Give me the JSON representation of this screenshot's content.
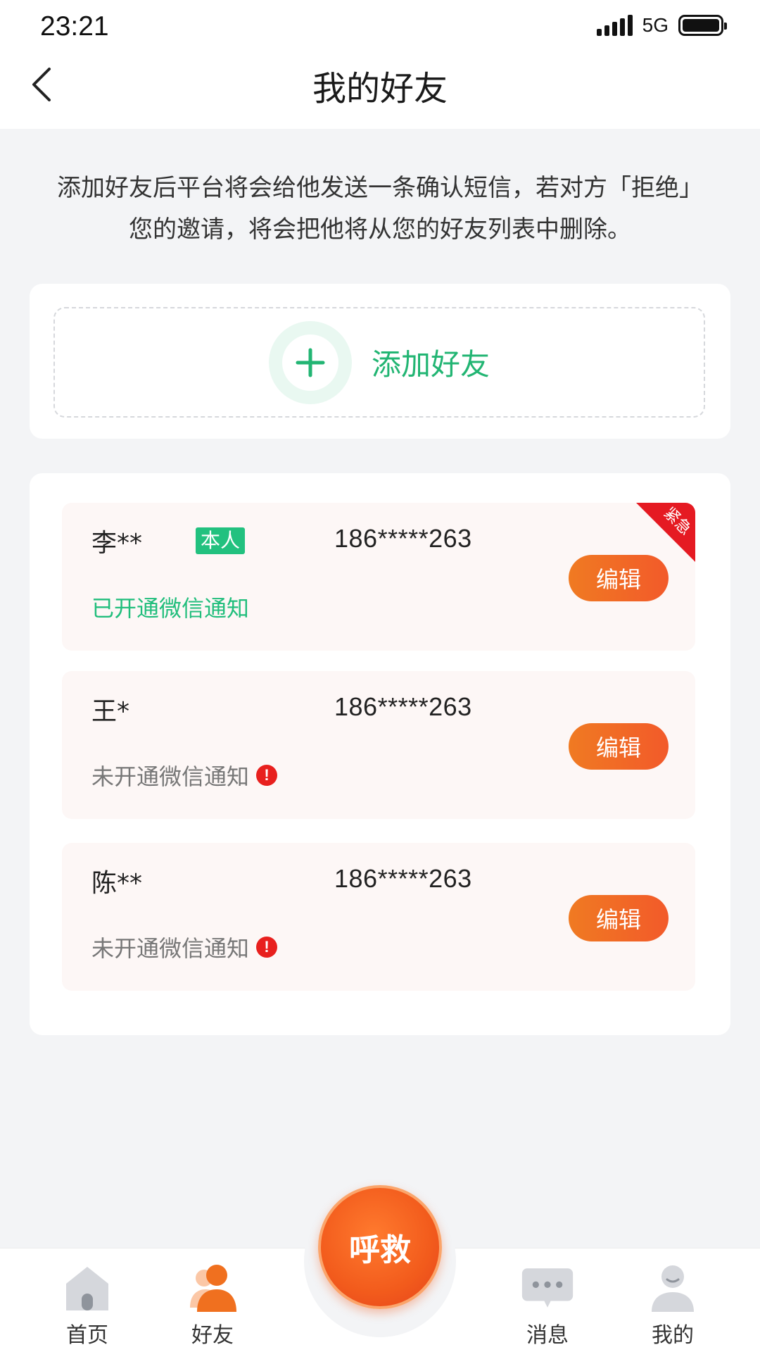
{
  "status_bar": {
    "time": "23:21",
    "network": "5G"
  },
  "header": {
    "title": "我的好友"
  },
  "notice": {
    "text": "添加好友后平台将会给他发送一条确认短信，若对方「拒绝」您的邀请，将会把他将从您的好友列表中删除。"
  },
  "add_friend": {
    "label": "添加好友"
  },
  "friends": [
    {
      "name": "李**",
      "badge": "本人",
      "phone": "186*****263",
      "wechat_status": "已开通微信通知",
      "wechat_enabled": true,
      "edit_label": "编辑",
      "tag": "紧急"
    },
    {
      "name": "王*",
      "phone": "186*****263",
      "wechat_status": "未开通微信通知",
      "wechat_enabled": false,
      "edit_label": "编辑"
    },
    {
      "name": "陈**",
      "phone": "186*****263",
      "wechat_status": "未开通微信通知",
      "wechat_enabled": false,
      "edit_label": "编辑"
    }
  ],
  "bottom_nav": {
    "home": "首页",
    "friends": "好友",
    "sos": "呼救",
    "messages": "消息",
    "me": "我的"
  },
  "colors": {
    "accent_green": "#22b573",
    "accent_orange": "#f0701f",
    "urgent_red": "#e51a22",
    "background": "#f3f4f6"
  }
}
